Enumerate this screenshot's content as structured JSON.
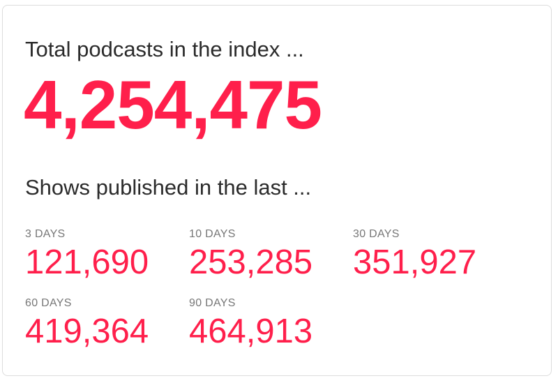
{
  "total": {
    "heading": "Total podcasts in the index ...",
    "value": "4,254,475"
  },
  "shows": {
    "heading": "Shows published in the last ...",
    "stats": [
      {
        "label": "3 DAYS",
        "value": "121,690"
      },
      {
        "label": "10 DAYS",
        "value": "253,285"
      },
      {
        "label": "30 DAYS",
        "value": "351,927"
      },
      {
        "label": "60 DAYS",
        "value": "419,364"
      },
      {
        "label": "90 DAYS",
        "value": "464,913"
      }
    ]
  },
  "colors": {
    "accent": "#ff1f4b",
    "heading_text": "#2b2b2b",
    "label_text": "#777777",
    "card_border": "#dcdcdc"
  }
}
